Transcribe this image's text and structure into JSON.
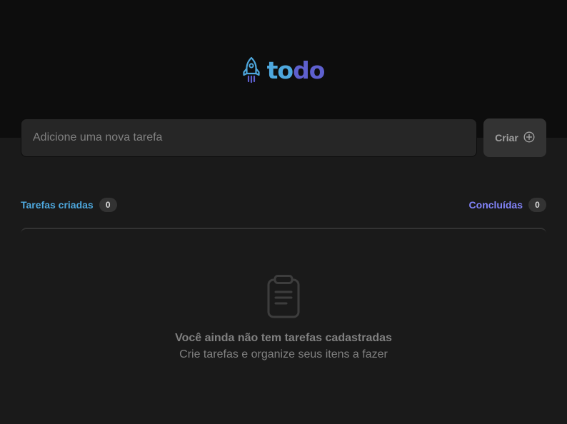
{
  "app": {
    "logo_text_part1": "to",
    "logo_text_part2": "do",
    "brand_colors": {
      "blue": "#4ea8de",
      "purple": "#5e60ce",
      "purple_light": "#8284fa"
    },
    "logo_icon": "rocket-icon"
  },
  "form": {
    "placeholder": "Adicione uma nova tarefa",
    "value": "",
    "create_label": "Criar",
    "create_icon": "plus-circle-icon"
  },
  "summary": {
    "created_label": "Tarefas criadas",
    "created_count": "0",
    "done_label": "Concluídas",
    "done_count": "0"
  },
  "empty_state": {
    "icon": "clipboard-icon",
    "title": "Você ainda não tem tarefas cadastradas",
    "subtitle": "Crie tarefas e organize seus itens a fazer"
  }
}
